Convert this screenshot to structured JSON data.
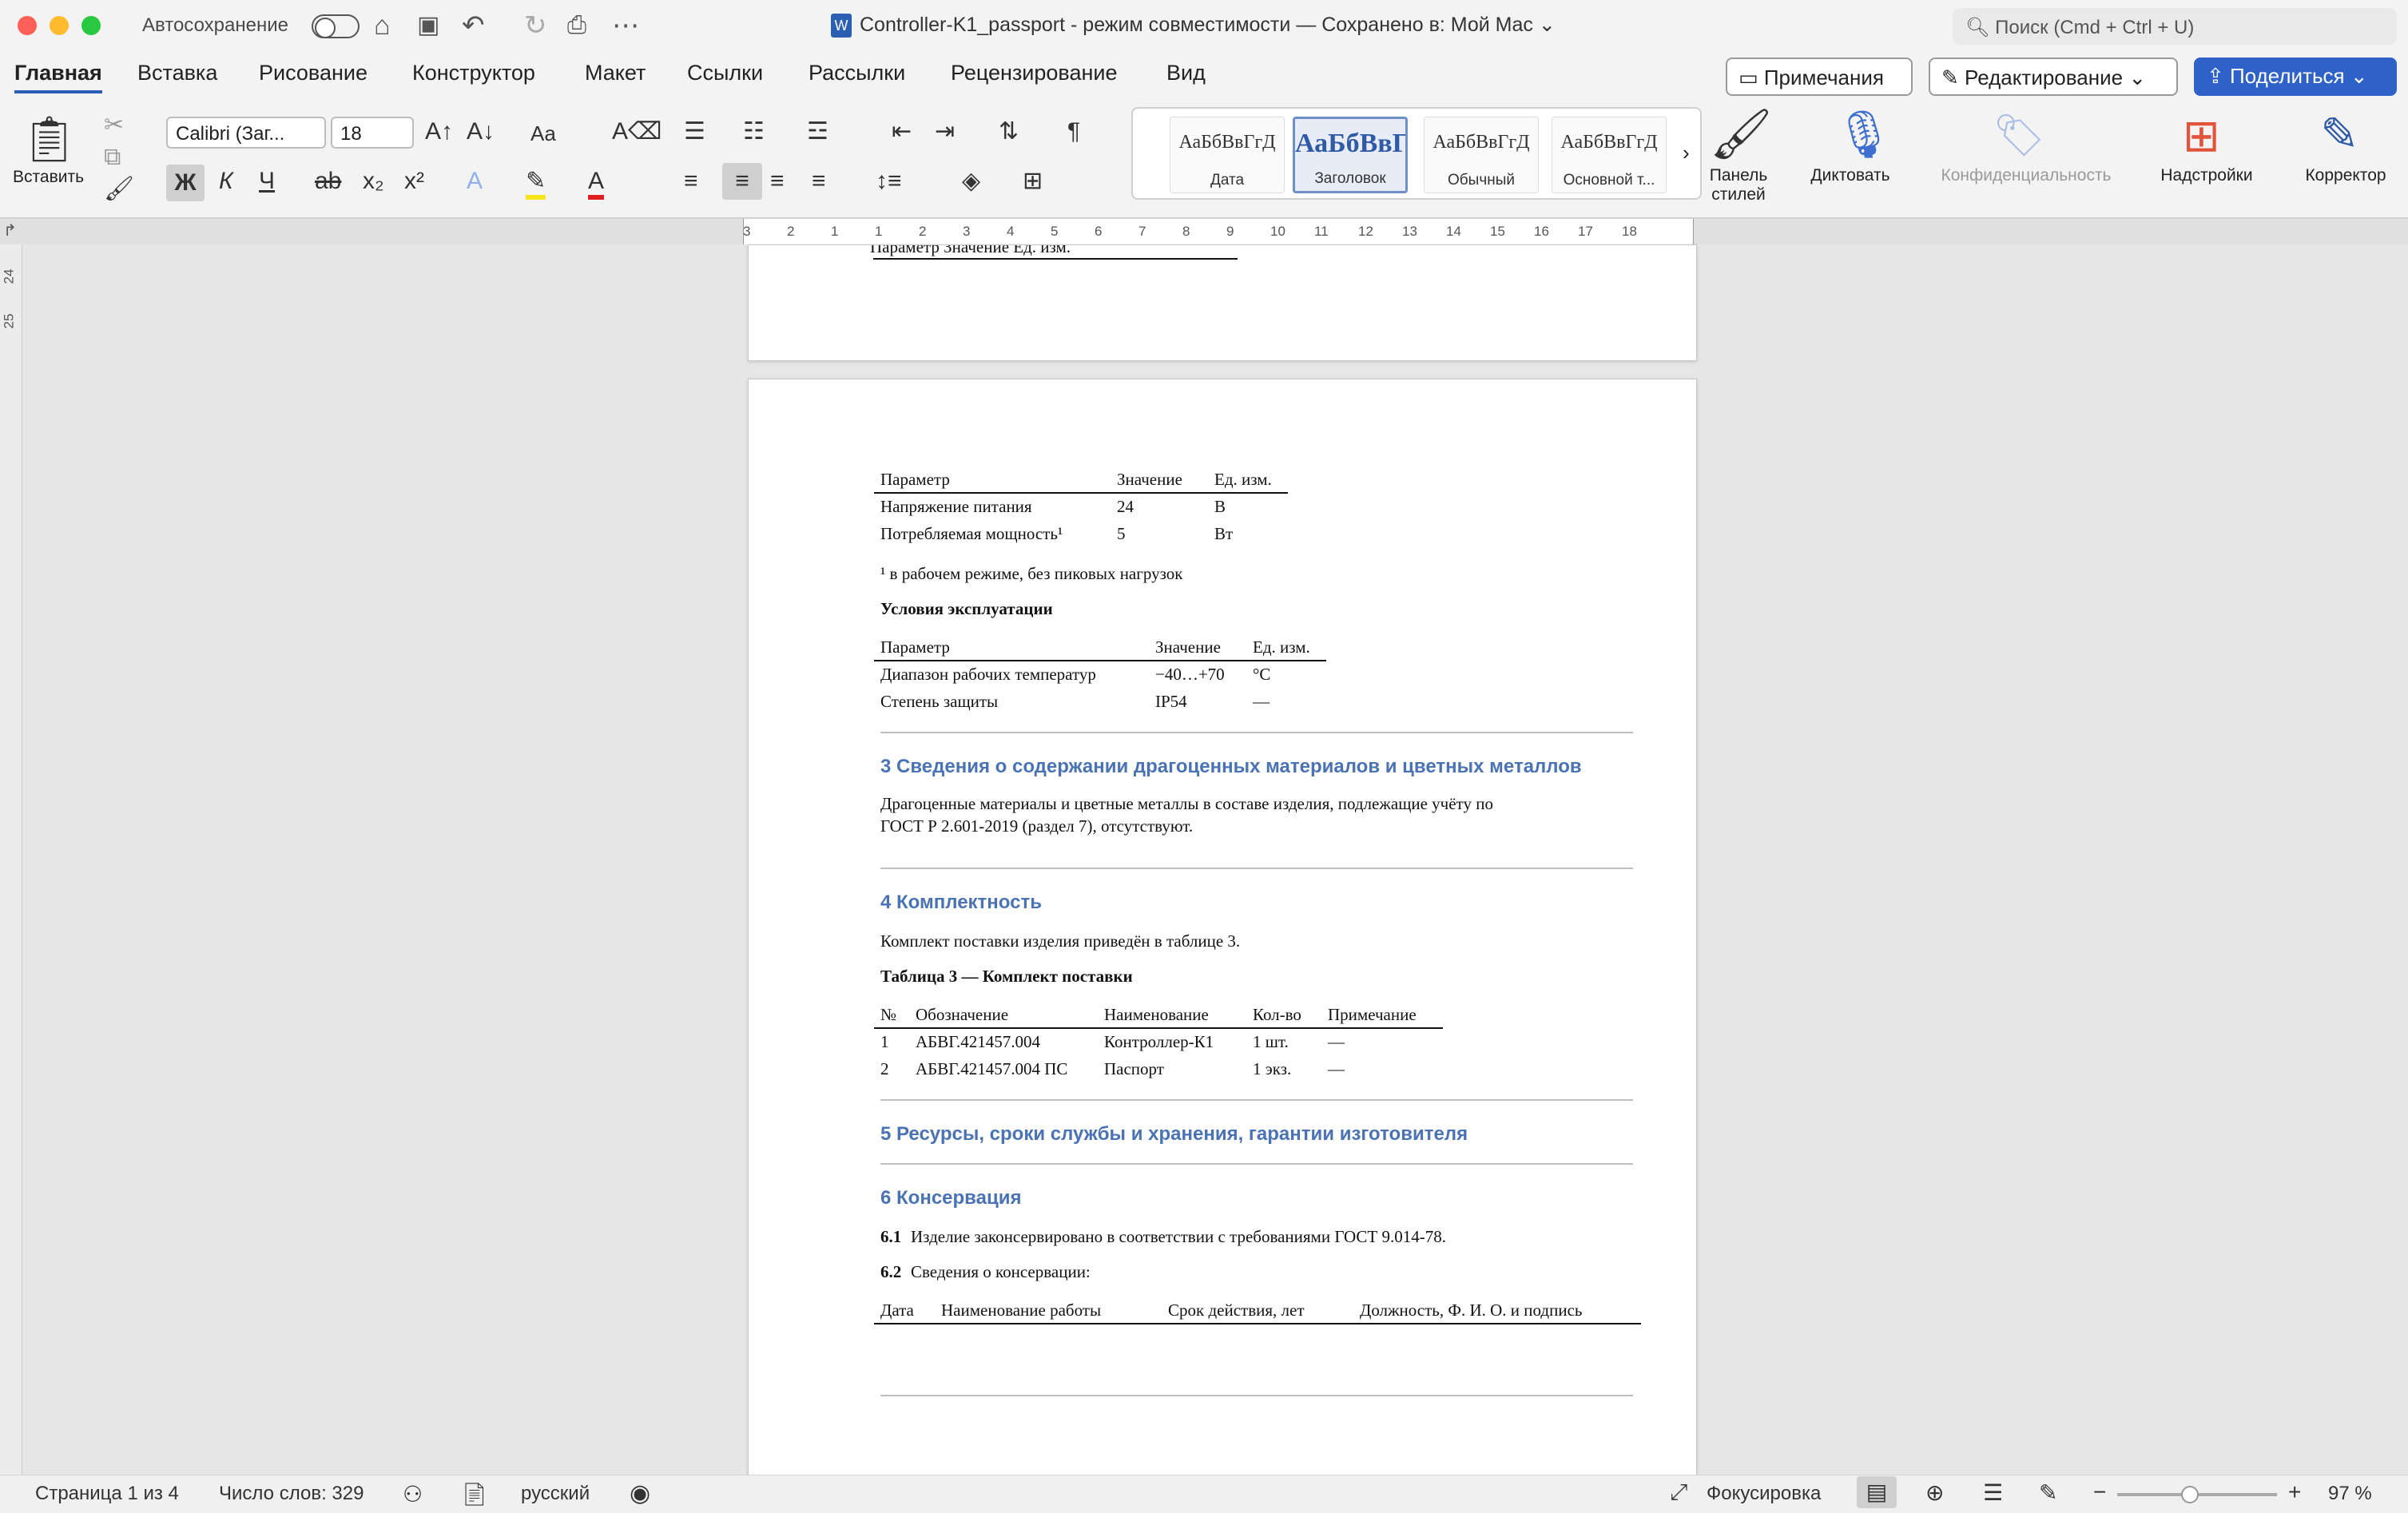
{
  "titlebar": {
    "autosave_label": "Автосохранение",
    "document_title": "Controller-K1_passport  -  режим совместимости — Сохранено в: Мой Mac",
    "search_placeholder": "Поиск (Cmd + Ctrl + U)"
  },
  "tabs": [
    "Главная",
    "Вставка",
    "Рисование",
    "Конструктор",
    "Макет",
    "Ссылки",
    "Рассылки",
    "Рецензирование",
    "Вид"
  ],
  "ribbon_right": {
    "comments": "Примечания",
    "editing": "Редактирование",
    "share": "Поделиться"
  },
  "ribbon": {
    "paste": "Вставить",
    "font_name": "Calibri (Заг...",
    "font_size": "18",
    "font_case": "Aa",
    "bold": "Ж",
    "italic": "К",
    "underline": "Ч",
    "strike": "ab",
    "subscript": "x₂",
    "superscript": "x²",
    "styles": [
      {
        "sample": "АаБбВвГгД",
        "label": "Дата"
      },
      {
        "sample": "АаБбВвГ",
        "label": "Заголовок"
      },
      {
        "sample": "АаБбВвГгД",
        "label": "Обычный"
      },
      {
        "sample": "АаБбВвГгД",
        "label": "Основной т..."
      }
    ],
    "styles_pane": "Панель стилей",
    "dictate": "Диктовать",
    "sensitivity": "Конфиденциальность",
    "addins": "Надстройки",
    "editor": "Корректор"
  },
  "ruler": [
    "3",
    "2",
    "1",
    "1",
    "2",
    "3",
    "4",
    "5",
    "6",
    "7",
    "8",
    "9",
    "10",
    "11",
    "12",
    "13",
    "14",
    "15",
    "16",
    "17",
    "18"
  ],
  "vruler": [
    "24",
    "25"
  ],
  "doc": {
    "cut_row": "Параметр                     Значение   Ед. изм.",
    "t1": {
      "header": [
        "Параметр",
        "Значение",
        "Ед. изм."
      ],
      "rows": [
        [
          "Напряжение питания",
          "24",
          "В"
        ],
        [
          "Потребляемая мощность¹",
          "5",
          "Вт"
        ]
      ]
    },
    "footnote": "¹ в рабочем режиме, без пиковых нагрузок",
    "conditions_title": "Условия эксплуатации",
    "t2": {
      "header": [
        "Параметр",
        "Значение",
        "Ед. изм."
      ],
      "rows": [
        [
          "Диапазон рабочих температур",
          "−40…+70",
          "°C"
        ],
        [
          "Степень защиты",
          "IP54",
          "—"
        ]
      ]
    },
    "sec3_title": "3 Сведения о содержании драгоценных материалов и цветных металлов",
    "sec3_line1": "Драгоценные материалы и цветные металлы в составе изделия, подлежащие учёту по",
    "sec3_line2": "ГОСТ Р 2.601-2019 (раздел 7), отсутствуют.",
    "sec4_title": "4 Комплектность",
    "sec4_text": "Комплект поставки изделия приведён в таблице 3.",
    "t3_title": "Таблица 3 — Комплект поставки",
    "t3": {
      "header": [
        "№",
        "Обозначение",
        "Наименование",
        "Кол-во",
        "Примечание"
      ],
      "rows": [
        [
          "1",
          "АБВГ.421457.004",
          "Контроллер-К1",
          "1 шт.",
          "—"
        ],
        [
          "2",
          "АБВГ.421457.004 ПС",
          "Паспорт",
          "1 экз.",
          "—"
        ]
      ]
    },
    "sec5_title": "5 Ресурсы, сроки службы и хранения, гарантии изготовителя",
    "sec6_title": "6 Консервация",
    "p61_num": "6.1",
    "p61_text": "Изделие законсервировано в соответствии с требованиями ГОСТ 9.014-78.",
    "p62_num": "6.2",
    "p62_text": "Сведения о консервации:",
    "t4_header": [
      "Дата",
      "Наименование работы",
      "Срок действия, лет",
      "Должность, Ф. И. О. и подпись"
    ]
  },
  "status": {
    "page": "Страница 1 из 4",
    "words": "Число слов: 329",
    "language": "русский",
    "focus": "Фокусировка",
    "zoom": "97 %",
    "zoom_level": 0.97
  },
  "colors": {
    "accent": "#2f62c9",
    "heading": "#4a73b5"
  }
}
